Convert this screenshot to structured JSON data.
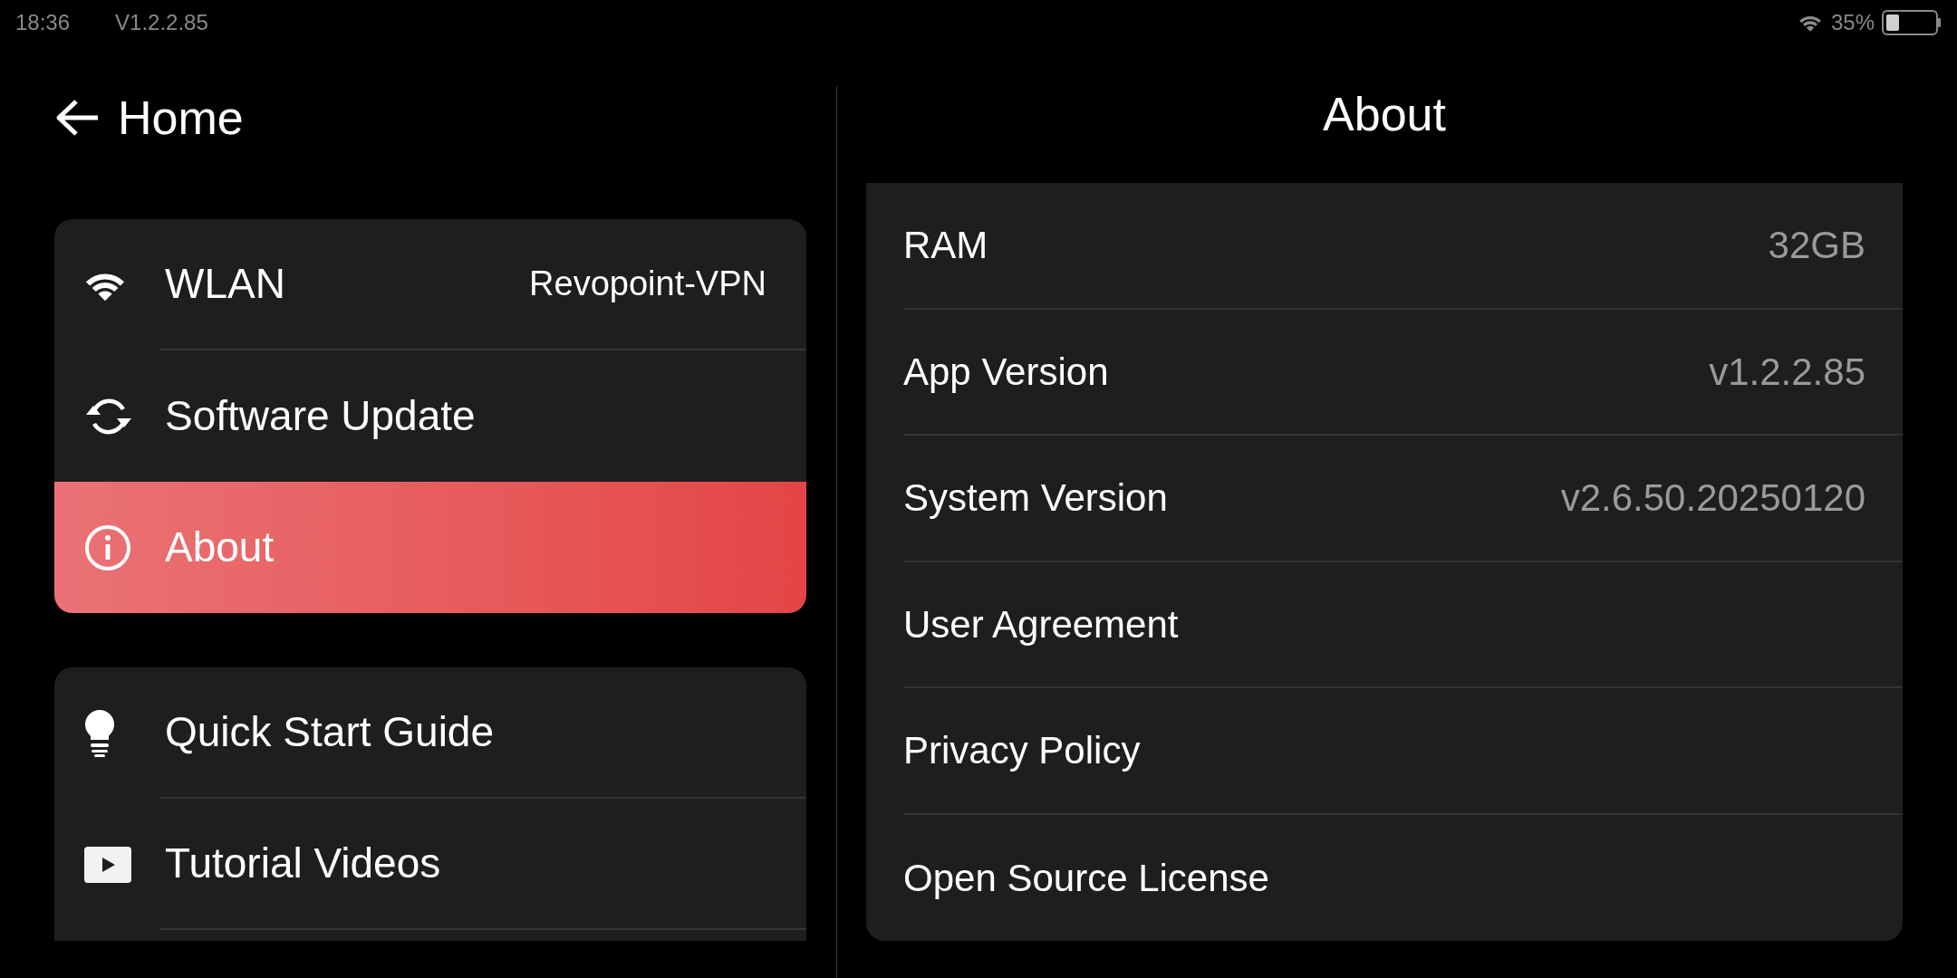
{
  "status_bar": {
    "time": "18:36",
    "version": "V1.2.2.85",
    "battery": "35%"
  },
  "header": {
    "back_label": "Home",
    "title": "About"
  },
  "menu_groups": [
    {
      "items": [
        {
          "label": "WLAN",
          "value": "Revopoint-VPN",
          "selected": false
        },
        {
          "label": "Software Update",
          "selected": false
        },
        {
          "label": "About",
          "selected": true
        }
      ],
      "cut_off": false
    },
    {
      "items": [
        {
          "label": "Quick Start Guide",
          "selected": false
        },
        {
          "label": "Tutorial Videos",
          "selected": false
        }
      ],
      "cut_off": true
    }
  ],
  "about_rows": [
    {
      "label": "RAM",
      "value": "32GB"
    },
    {
      "label": "App Version",
      "value": "v1.2.2.85"
    },
    {
      "label": "System Version",
      "value": "v2.6.50.20250120"
    },
    {
      "label": "User Agreement"
    },
    {
      "label": "Privacy Policy"
    },
    {
      "label": "Open Source License"
    }
  ]
}
